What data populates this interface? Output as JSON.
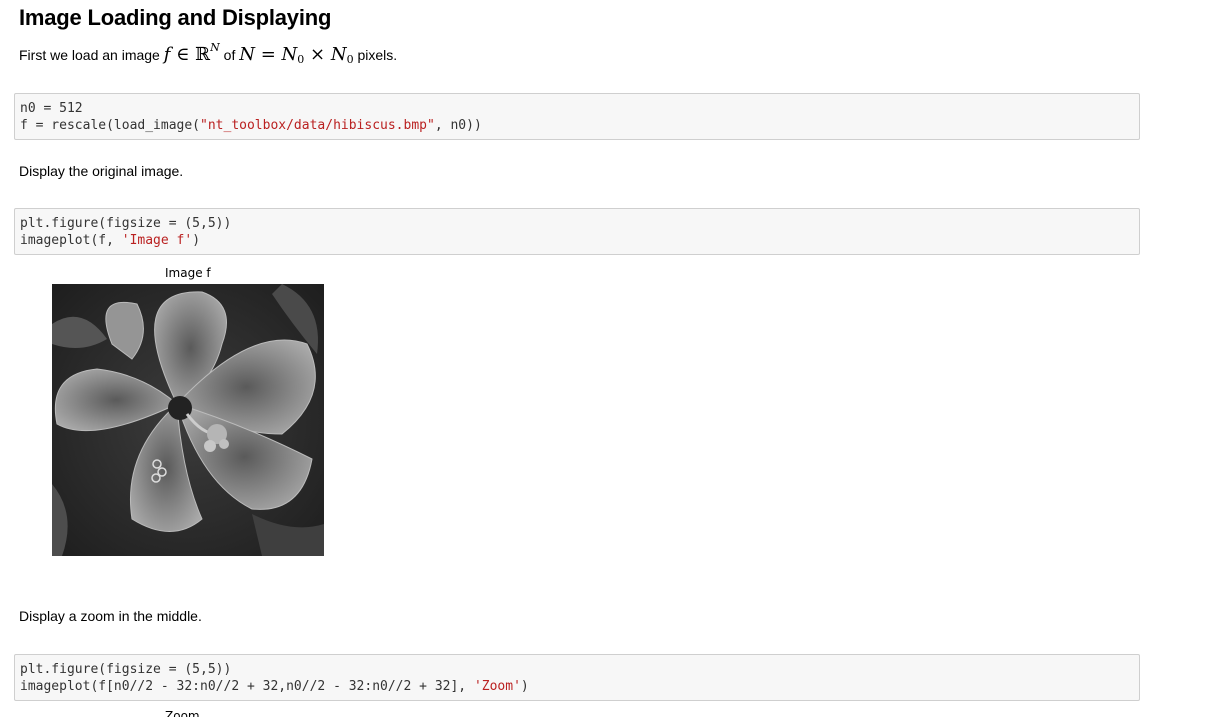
{
  "heading": "Image Loading and Displaying",
  "intro": {
    "prefix": "First we load an image",
    "of": "of",
    "suffix": "pixels."
  },
  "cell1": {
    "line1_a": "n0 = 512",
    "line2_a": "f = rescale(load_image(",
    "line2_str": "\"nt_toolbox/data/hibiscus.bmp\"",
    "line2_b": ", n0))"
  },
  "text2": "Display the original image.",
  "cell2": {
    "line1": "plt.figure(figsize = (5,5))",
    "line2_a": "imageplot(f, ",
    "line2_str": "'Image f'",
    "line2_b": ")"
  },
  "figure1": {
    "title": "Image f",
    "icon": "hibiscus-grayscale-image"
  },
  "text3": "Display a zoom in the middle.",
  "cell3": {
    "line1": "plt.figure(figsize = (5,5))",
    "line2_a": "imageplot(f[n0//2 - 32:n0//2 + 32,n0//2 - 32:n0//2 + 32], ",
    "line2_str": "'Zoom'",
    "line2_b": ")"
  },
  "figure2": {
    "title": "Zoom"
  }
}
